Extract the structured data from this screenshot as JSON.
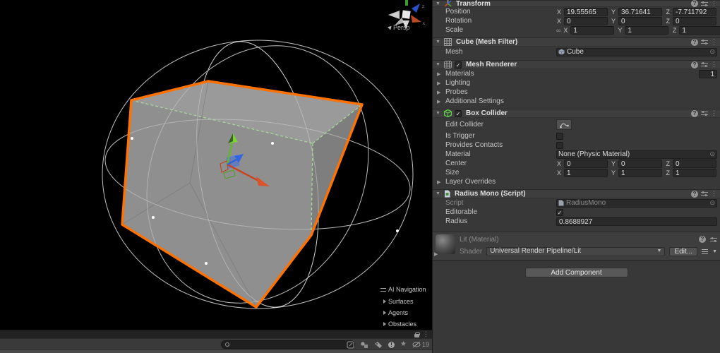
{
  "scene": {
    "view_mode_label": "Persp",
    "gizmo_axis_labels": {
      "x": "x",
      "z": "z"
    },
    "selection_color": "#ff7100",
    "nav_overlay": {
      "title": "AI Navigation",
      "items": [
        "Surfaces",
        "Agents",
        "Obstacles"
      ]
    }
  },
  "bottom_bar": {
    "hidden_count": "19"
  },
  "inspector": {
    "axis": {
      "x": "X",
      "y": "Y",
      "z": "Z"
    },
    "transform": {
      "title": "Transform",
      "position": {
        "label": "Position",
        "x": "19.55565",
        "y": "36.71641",
        "z": "-7.711792"
      },
      "rotation": {
        "label": "Rotation",
        "x": "0",
        "y": "0",
        "z": "0"
      },
      "scale": {
        "label": "Scale",
        "x": "1",
        "y": "1",
        "z": "1"
      }
    },
    "mesh_filter": {
      "title": "Cube (Mesh Filter)",
      "mesh_label": "Mesh",
      "mesh_value": "Cube"
    },
    "mesh_renderer": {
      "title": "Mesh Renderer",
      "materials_label": "Materials",
      "materials_count": "1",
      "foldouts": [
        "Lighting",
        "Probes",
        "Additional Settings"
      ]
    },
    "box_collider": {
      "title": "Box Collider",
      "edit_collider_label": "Edit Collider",
      "is_trigger_label": "Is Trigger",
      "provides_contacts_label": "Provides Contacts",
      "material_label": "Material",
      "material_value": "None (Physic Material)",
      "center": {
        "label": "Center",
        "x": "0",
        "y": "0",
        "z": "0"
      },
      "size": {
        "label": "Size",
        "x": "1",
        "y": "1",
        "z": "1"
      },
      "layer_overrides_label": "Layer Overrides"
    },
    "radius_mono": {
      "title": "Radius Mono (Script)",
      "script_label": "Script",
      "script_value": "RadiusMono",
      "editorable_label": "Editorable",
      "radius_label": "Radius",
      "radius_value": "0.8688927"
    },
    "material": {
      "title": "Lit (Material)",
      "shader_label": "Shader",
      "shader_value": "Universal Render Pipeline/Lit",
      "edit_button": "Edit..."
    },
    "add_component_label": "Add Component"
  }
}
